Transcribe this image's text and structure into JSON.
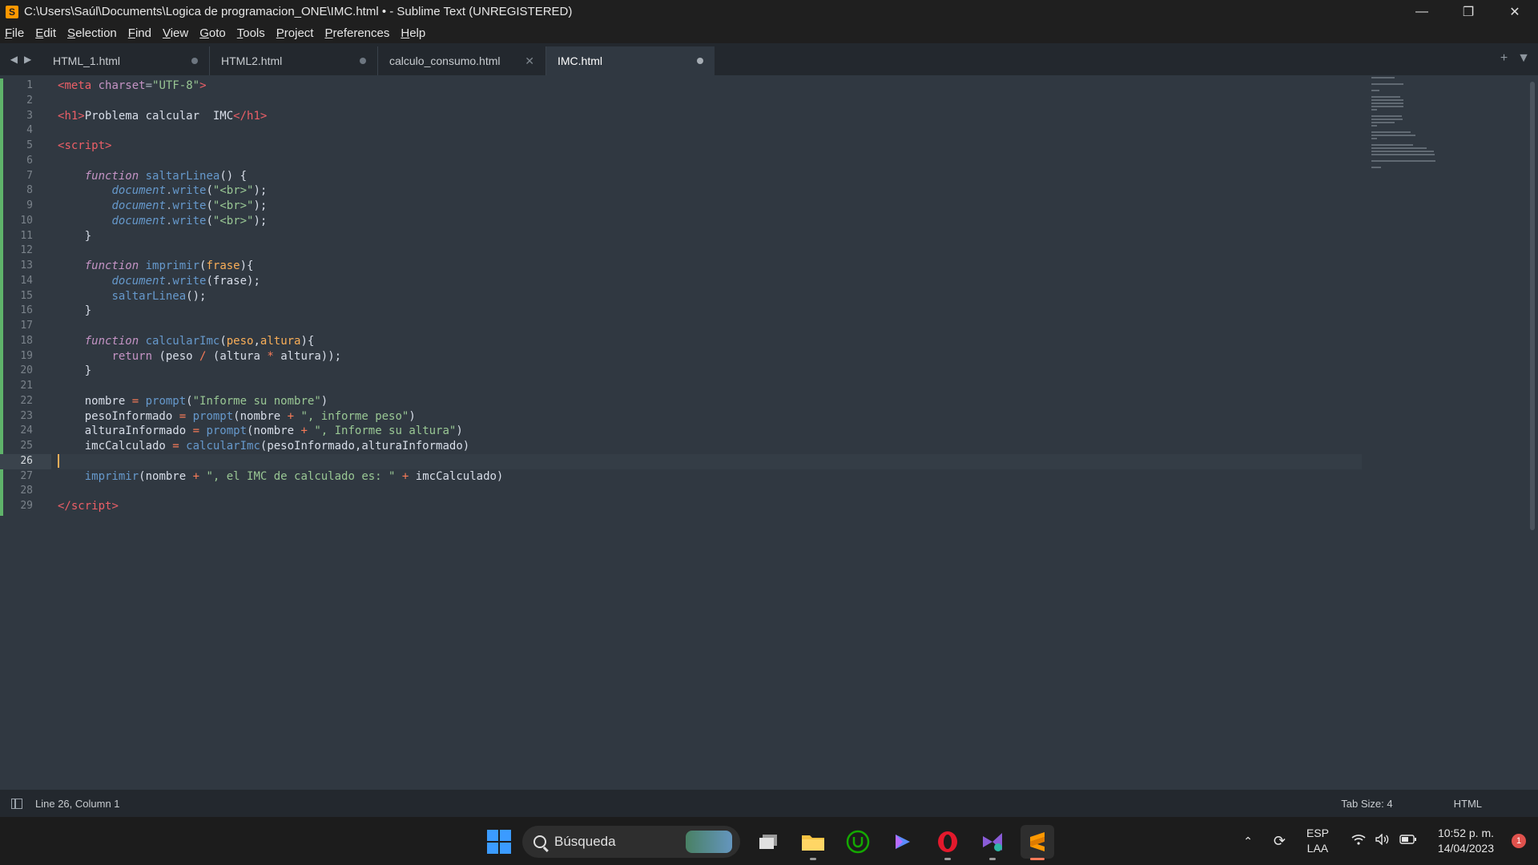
{
  "window": {
    "title": "C:\\Users\\Saúl\\Documents\\Logica de programacion_ONE\\IMC.html • - Sublime Text (UNREGISTERED)",
    "controls": {
      "minimize": "—",
      "restore": "❐",
      "close": "✕"
    }
  },
  "menu": [
    "File",
    "Edit",
    "Selection",
    "Find",
    "View",
    "Goto",
    "Tools",
    "Project",
    "Preferences",
    "Help"
  ],
  "tabs": [
    {
      "label": "HTML_1.html",
      "state": "modified"
    },
    {
      "label": "HTML2.html",
      "state": "modified"
    },
    {
      "label": "calculo_consumo.html",
      "state": "close"
    },
    {
      "label": "IMC.html",
      "state": "modified",
      "active": true
    }
  ],
  "editor": {
    "current_line": 26,
    "lines": [
      [
        [
          "t-tag",
          "<"
        ],
        [
          "t-tag",
          "meta"
        ],
        [
          "t-plain",
          " "
        ],
        [
          "t-attr",
          "charset"
        ],
        [
          "t-punct",
          "="
        ],
        [
          "t-str",
          "\"UTF-8\""
        ],
        [
          "t-tag",
          ">"
        ]
      ],
      [],
      [
        [
          "t-tag",
          "<"
        ],
        [
          "t-tag",
          "h1"
        ],
        [
          "t-tag",
          ">"
        ],
        [
          "t-plain",
          "Problema calcular  IMC"
        ],
        [
          "t-tag",
          "</"
        ],
        [
          "t-tag",
          "h1"
        ],
        [
          "t-tag",
          ">"
        ]
      ],
      [],
      [
        [
          "t-tag",
          "<"
        ],
        [
          "t-tag",
          "script"
        ],
        [
          "t-tag",
          ">"
        ]
      ],
      [],
      [
        [
          "t-plain",
          "    "
        ],
        [
          "t-kw",
          "function"
        ],
        [
          "t-plain",
          " "
        ],
        [
          "t-fn",
          "saltarLinea"
        ],
        [
          "t-plain",
          "() {"
        ]
      ],
      [
        [
          "t-plain",
          "        "
        ],
        [
          "t-obj",
          "document"
        ],
        [
          "t-punct",
          "."
        ],
        [
          "t-fn",
          "write"
        ],
        [
          "t-plain",
          "("
        ],
        [
          "t-str",
          "\"<br>\""
        ],
        [
          "t-plain",
          ");"
        ]
      ],
      [
        [
          "t-plain",
          "        "
        ],
        [
          "t-obj",
          "document"
        ],
        [
          "t-punct",
          "."
        ],
        [
          "t-fn",
          "write"
        ],
        [
          "t-plain",
          "("
        ],
        [
          "t-str",
          "\"<br>\""
        ],
        [
          "t-plain",
          ");"
        ]
      ],
      [
        [
          "t-plain",
          "        "
        ],
        [
          "t-obj",
          "document"
        ],
        [
          "t-punct",
          "."
        ],
        [
          "t-fn",
          "write"
        ],
        [
          "t-plain",
          "("
        ],
        [
          "t-str",
          "\"<br>\""
        ],
        [
          "t-plain",
          ");"
        ]
      ],
      [
        [
          "t-plain",
          "    }"
        ]
      ],
      [],
      [
        [
          "t-plain",
          "    "
        ],
        [
          "t-kw",
          "function"
        ],
        [
          "t-plain",
          " "
        ],
        [
          "t-fn",
          "imprimir"
        ],
        [
          "t-plain",
          "("
        ],
        [
          "t-param",
          "frase"
        ],
        [
          "t-plain",
          "){"
        ]
      ],
      [
        [
          "t-plain",
          "        "
        ],
        [
          "t-obj",
          "document"
        ],
        [
          "t-punct",
          "."
        ],
        [
          "t-fn",
          "write"
        ],
        [
          "t-plain",
          "(frase);"
        ]
      ],
      [
        [
          "t-plain",
          "        "
        ],
        [
          "t-fn",
          "saltarLinea"
        ],
        [
          "t-plain",
          "();"
        ]
      ],
      [
        [
          "t-plain",
          "    }"
        ]
      ],
      [],
      [
        [
          "t-plain",
          "    "
        ],
        [
          "t-kw",
          "function"
        ],
        [
          "t-plain",
          " "
        ],
        [
          "t-fn",
          "calcularImc"
        ],
        [
          "t-plain",
          "("
        ],
        [
          "t-param",
          "peso"
        ],
        [
          "t-plain",
          ","
        ],
        [
          "t-param",
          "altura"
        ],
        [
          "t-plain",
          "){"
        ]
      ],
      [
        [
          "t-plain",
          "        "
        ],
        [
          "t-attr",
          "return"
        ],
        [
          "t-plain",
          " (peso "
        ],
        [
          "t-op",
          "/"
        ],
        [
          "t-plain",
          " (altura "
        ],
        [
          "t-op",
          "*"
        ],
        [
          "t-plain",
          " altura));"
        ]
      ],
      [
        [
          "t-plain",
          "    }"
        ]
      ],
      [],
      [
        [
          "t-plain",
          "    nombre "
        ],
        [
          "t-op",
          "="
        ],
        [
          "t-plain",
          " "
        ],
        [
          "t-fn",
          "prompt"
        ],
        [
          "t-plain",
          "("
        ],
        [
          "t-str",
          "\"Informe su nombre\""
        ],
        [
          "t-plain",
          ")"
        ]
      ],
      [
        [
          "t-plain",
          "    pesoInformado "
        ],
        [
          "t-op",
          "="
        ],
        [
          "t-plain",
          " "
        ],
        [
          "t-fn",
          "prompt"
        ],
        [
          "t-plain",
          "(nombre "
        ],
        [
          "t-op",
          "+"
        ],
        [
          "t-plain",
          " "
        ],
        [
          "t-str",
          "\", informe peso\""
        ],
        [
          "t-plain",
          ")"
        ]
      ],
      [
        [
          "t-plain",
          "    alturaInformado "
        ],
        [
          "t-op",
          "="
        ],
        [
          "t-plain",
          " "
        ],
        [
          "t-fn",
          "prompt"
        ],
        [
          "t-plain",
          "(nombre "
        ],
        [
          "t-op",
          "+"
        ],
        [
          "t-plain",
          " "
        ],
        [
          "t-str",
          "\", Informe su altura\""
        ],
        [
          "t-plain",
          ")"
        ]
      ],
      [
        [
          "t-plain",
          "    imcCalculado "
        ],
        [
          "t-op",
          "="
        ],
        [
          "t-plain",
          " "
        ],
        [
          "t-fn",
          "calcularImc"
        ],
        [
          "t-plain",
          "(pesoInformado,alturaInformado)"
        ]
      ],
      [],
      [
        [
          "t-plain",
          "    "
        ],
        [
          "t-fn",
          "imprimir"
        ],
        [
          "t-plain",
          "(nombre "
        ],
        [
          "t-op",
          "+"
        ],
        [
          "t-plain",
          " "
        ],
        [
          "t-str",
          "\", el IMC de calculado es: \""
        ],
        [
          "t-plain",
          " "
        ],
        [
          "t-op",
          "+"
        ],
        [
          "t-plain",
          " imcCalculado)"
        ]
      ],
      [],
      [
        [
          "t-tag",
          "</"
        ],
        [
          "t-tag",
          "script"
        ],
        [
          "t-tag",
          ">"
        ]
      ]
    ]
  },
  "status": {
    "position": "Line 26, Column 1",
    "tab_size": "Tab Size: 4",
    "syntax": "HTML"
  },
  "taskbar": {
    "search_placeholder": "Búsqueda",
    "lang_line1": "ESP",
    "lang_line2": "LAA",
    "time": "10:52 p. m.",
    "date": "14/04/2023",
    "notifications": "1"
  }
}
